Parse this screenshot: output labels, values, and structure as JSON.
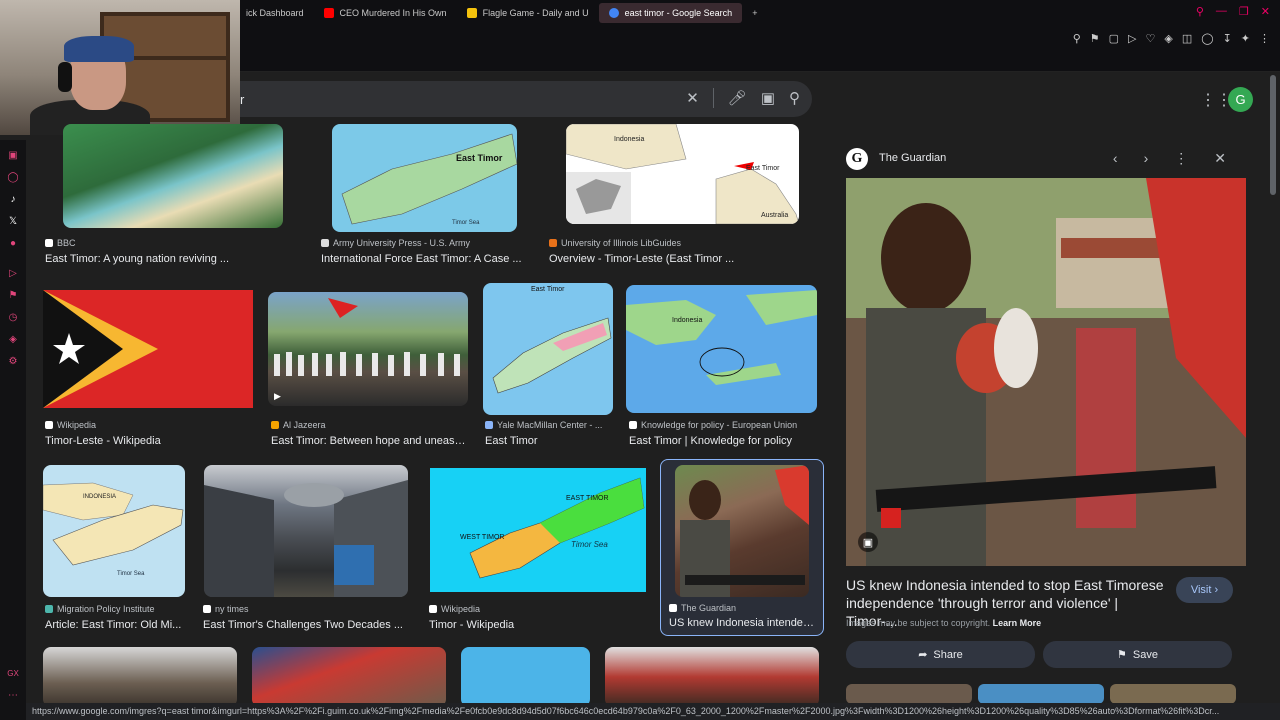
{
  "browser": {
    "tabs": [
      {
        "label": "ick Dashboard",
        "color": "#53fc18"
      },
      {
        "label": "CEO Murdered In His Own",
        "color": "#ff0000"
      },
      {
        "label": "Flagle Game - Daily and U",
        "color": "#f4c20d"
      },
      {
        "label": "east timor - Google Search",
        "color": "#4285f4",
        "active": true
      }
    ],
    "new_tab": "+"
  },
  "search": {
    "query": "r",
    "avatar_letter": "G"
  },
  "results": [
    {
      "source": "BBC",
      "title": "East Timor: A young nation reviving ..."
    },
    {
      "source": "Army University Press - U.S. Army",
      "title": "International Force East Timor: A Case ...",
      "map_label": "East Timor",
      "map_sea": "Timor Sea"
    },
    {
      "source": "University of Illinois LibGuides",
      "title": "Overview - Timor-Leste (East Timor ...",
      "map_label": "East Timor",
      "map_label2": "Indonesia",
      "map_label3": "Australia"
    },
    {
      "source": "Wikipedia",
      "title": "Timor-Leste - Wikipedia"
    },
    {
      "source": "Al Jazeera",
      "title": "East Timor: Between hope and unease..."
    },
    {
      "source": "Yale MacMillan Center - ...",
      "title": "East Timor",
      "map_label": "East Timor"
    },
    {
      "source": "Knowledge for policy - European Union",
      "title": "East Timor | Knowledge for policy",
      "map_label": "Indonesia"
    },
    {
      "source": "Migration Policy Institute",
      "title": "Article: East Timor: Old Mi...",
      "map_label": "INDONESIA",
      "map_sea": "Timor Sea"
    },
    {
      "source": "ny times",
      "title": "East Timor's Challenges Two Decades ..."
    },
    {
      "source": "Wikipedia",
      "title": "Timor - Wikipedia",
      "map_label": "EAST TIMOR",
      "map_label2": "WEST TIMOR",
      "map_sea": "Timor Sea"
    },
    {
      "source": "The Guardian",
      "title": "US knew Indonesia intended..."
    }
  ],
  "panel": {
    "source": "The Guardian",
    "title": "US knew Indonesia intended to stop East Timorese independence 'through terror and violence' | Timor-...",
    "visit": "Visit",
    "copyright": "Images may be subject to copyright.",
    "learn_more": "Learn More",
    "share": "Share",
    "save": "Save"
  },
  "status_url": "https://www.google.com/imgres?q=east timor&imgurl=https%3A%2F%2Fi.guim.co.uk%2Fimg%2Fmedia%2Fe0fcb0e9dc8d94d5d07f6bc646c0ecd64b979c0a%2F0_63_2000_1200%2Fmaster%2F2000.jpg%3Fwidth%3D1200%26height%3D1200%26quality%3D85%26auto%3Dformat%26fit%3Dcr..."
}
